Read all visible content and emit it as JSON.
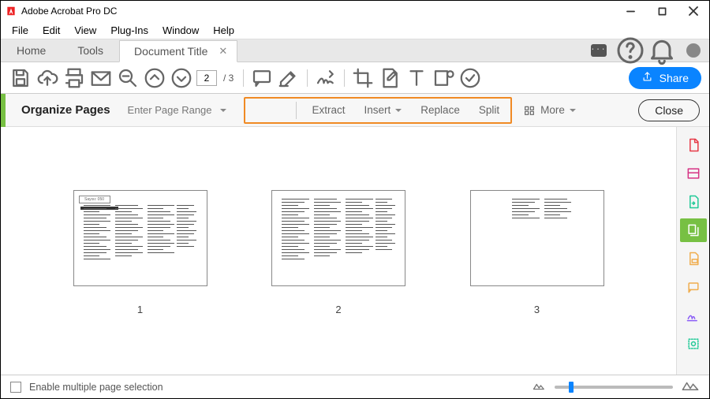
{
  "app": {
    "name": "Adobe Acrobat Pro DC"
  },
  "menubar": [
    "File",
    "Edit",
    "View",
    "Plug-Ins",
    "Window",
    "Help"
  ],
  "tabs": {
    "home": "Home",
    "tools": "Tools",
    "document": "Document Title"
  },
  "toolbar": {
    "page_current": "2",
    "page_total": "/ 3",
    "share_label": "Share"
  },
  "organize": {
    "title": "Organize Pages",
    "range_label": "Enter Page Range",
    "extract": "Extract",
    "insert": "Insert",
    "replace": "Replace",
    "split": "Split",
    "more": "More",
    "close": "Close"
  },
  "thumbnails": {
    "badge": "Sayısı: 050",
    "pages": [
      "1",
      "2",
      "3"
    ]
  },
  "footer": {
    "multi_select": "Enable multiple page selection"
  },
  "colors": {
    "accent_blue": "#0a84ff",
    "accent_green": "#77c043",
    "highlight_orange": "#f08a24"
  }
}
